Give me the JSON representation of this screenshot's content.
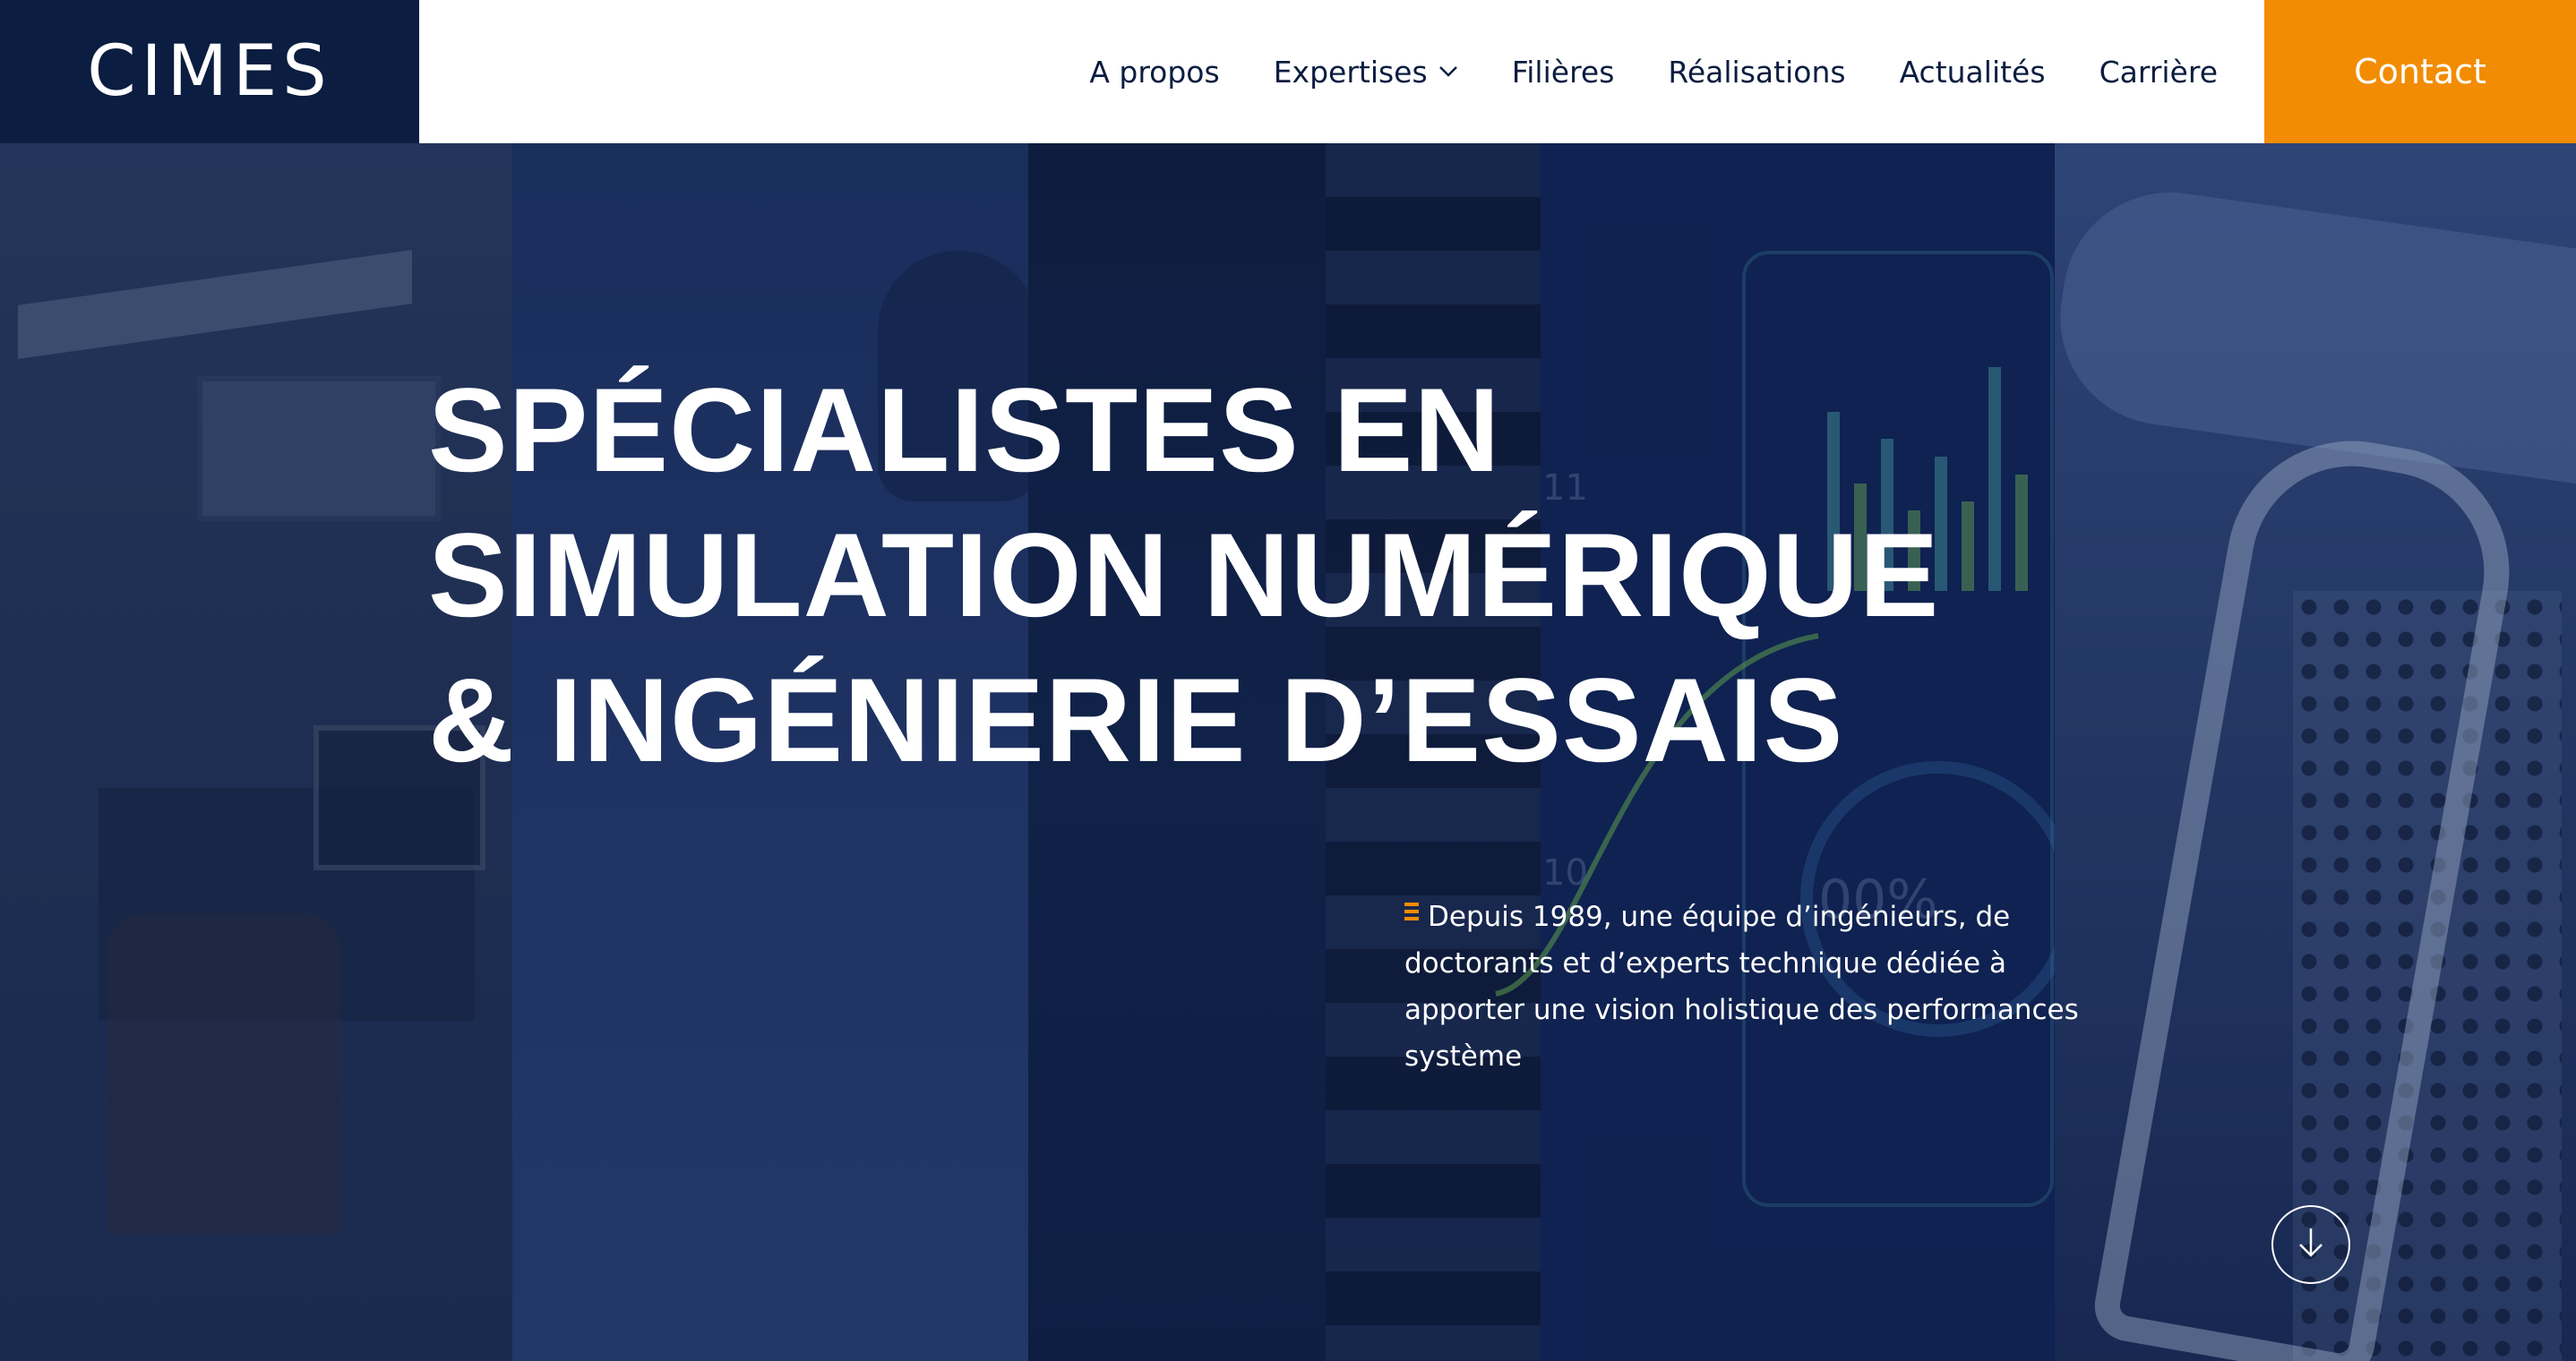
{
  "header": {
    "logo_text": "CIMES",
    "nav": [
      {
        "label": "A propos"
      },
      {
        "label": "Expertises",
        "has_dropdown": true
      },
      {
        "label": "Filières"
      },
      {
        "label": "Réalisations"
      },
      {
        "label": "Actualités"
      },
      {
        "label": "Carrière"
      }
    ],
    "contact_label": "Contact"
  },
  "hero": {
    "title_lines": [
      "SPÉCIALISTES EN",
      "SIMULATION NUMÉRIQUE",
      "& INGÉNIERIE D’ESSAIS"
    ],
    "description": "Depuis 1989, une équipe d’ingénieurs, de doctorants et d’experts technique dédiée à apporter une vision holistique des performances système",
    "background_labels": {
      "tick_top": "11",
      "tick_bottom": "10",
      "dial_value": "00%"
    },
    "scroll_icon": "arrow-down-icon"
  },
  "colors": {
    "navy": "#0b1d40",
    "accent_orange": "#f28c02",
    "white": "#ffffff"
  }
}
